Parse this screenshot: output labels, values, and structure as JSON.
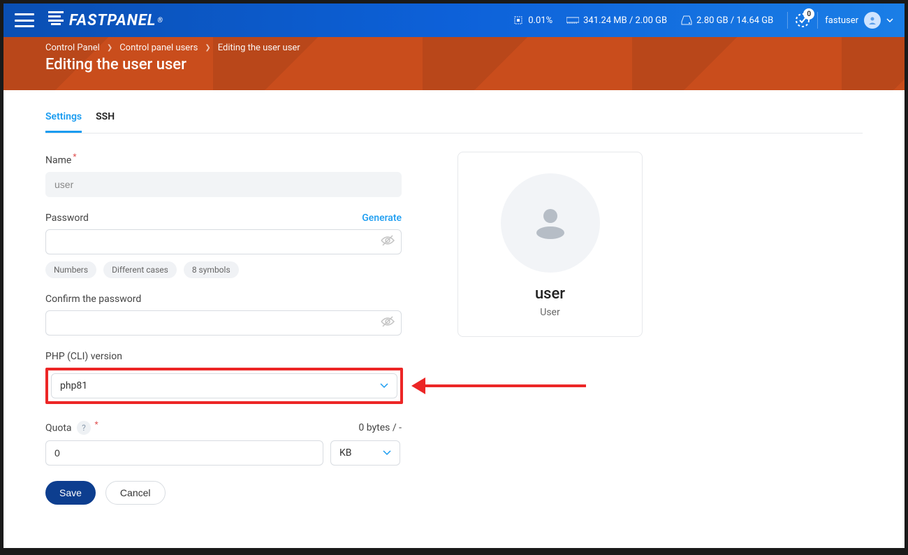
{
  "topbar": {
    "logo_text": "FASTPANEL",
    "cpu_pct": "0.01%",
    "mem": "341.24 MB / 2.00 GB",
    "disk": "2.80 GB / 14.64 GB",
    "tasks_count": "0",
    "username": "fastuser"
  },
  "hero": {
    "breadcrumb": {
      "a": "Control Panel",
      "b": "Control panel users",
      "c": "Editing the user user"
    },
    "title": "Editing the user user"
  },
  "tabs": {
    "settings": "Settings",
    "ssh": "SSH"
  },
  "form": {
    "name_label": "Name",
    "name_value": "user",
    "password_label": "Password",
    "generate": "Generate",
    "chip_numbers": "Numbers",
    "chip_cases": "Different cases",
    "chip_len": "8 symbols",
    "confirm_label": "Confirm the password",
    "phpcli_label": "PHP (CLI) version",
    "phpcli_value": "php81",
    "quota_label": "Quota",
    "quota_display": "0 bytes / -",
    "quota_value": "0",
    "quota_unit": "KB",
    "save_label": "Save",
    "cancel_label": "Cancel"
  },
  "profile": {
    "name": "user",
    "role": "User"
  }
}
